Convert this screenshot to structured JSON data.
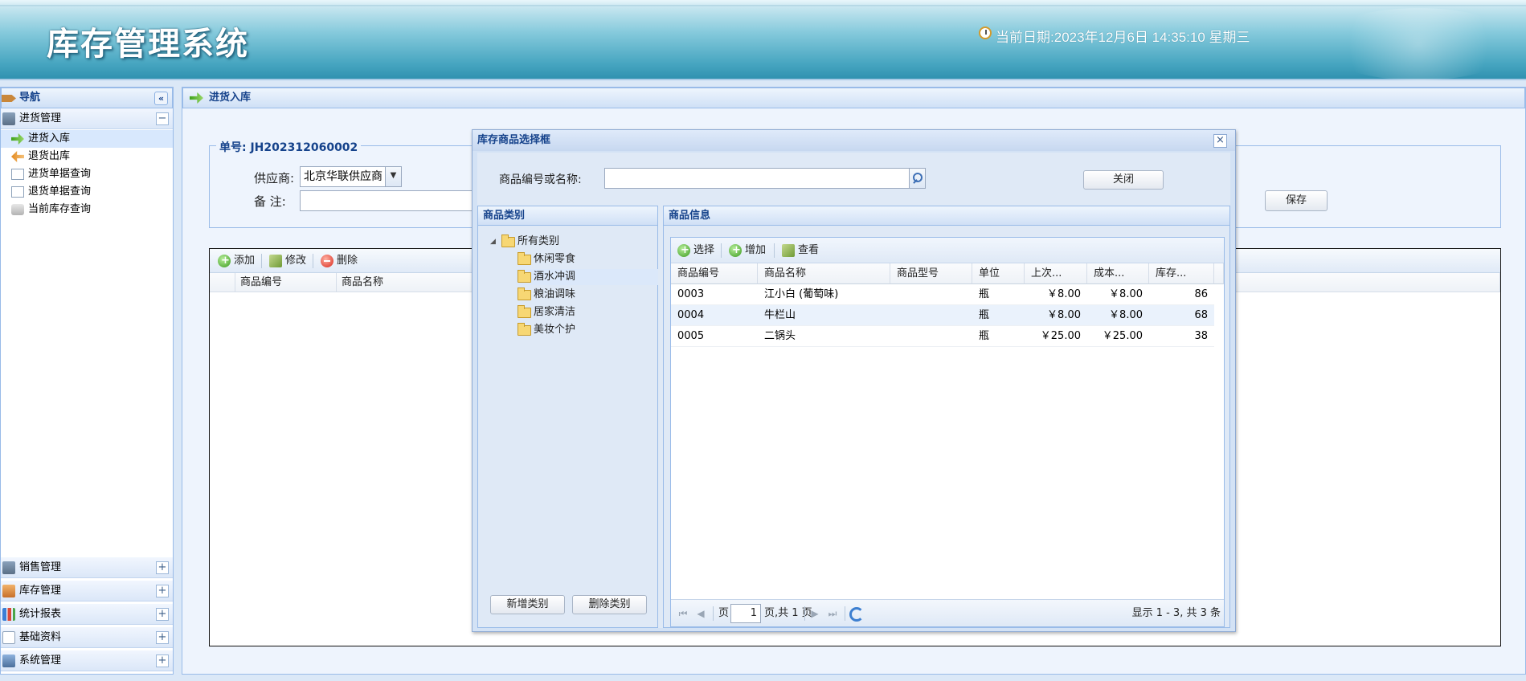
{
  "header": {
    "app_title": "库存管理系统",
    "date_label": "当前日期:",
    "date_value": "2023年12月6日 14:35:10 星期三"
  },
  "nav": {
    "title": "导航",
    "collapse": "«",
    "groups_top": [
      {
        "label": "进货管理",
        "toggle": "−"
      }
    ],
    "items": [
      {
        "label": "进货入库",
        "selected": true
      },
      {
        "label": "退货出库"
      },
      {
        "label": "进货单据查询"
      },
      {
        "label": "退货单据查询"
      },
      {
        "label": "当前库存查询"
      }
    ],
    "groups_bottom": [
      {
        "label": "销售管理",
        "toggle": "+"
      },
      {
        "label": "库存管理",
        "toggle": "+"
      },
      {
        "label": "统计报表",
        "toggle": "+"
      },
      {
        "label": "基础资料",
        "toggle": "+"
      },
      {
        "label": "系统管理",
        "toggle": "+"
      }
    ]
  },
  "main": {
    "tab_title": "进货入库",
    "order_no": "单号: JH202312060002",
    "supplier_label": "供应商:",
    "supplier_value": "北京华联供应商",
    "remark_label": "备 注:",
    "save_label": "保存",
    "toolbar": {
      "add": "添加",
      "edit": "修改",
      "delete": "删除"
    },
    "columns": [
      "商品编号",
      "商品名称"
    ]
  },
  "dialog": {
    "title": "库存商品选择框",
    "close_icon": "×",
    "search_label": "商品编号或名称:",
    "search_value": "",
    "close_button": "关闭",
    "category_panel": {
      "title": "商品类别",
      "root": "所有类别",
      "children": [
        "休闲零食",
        "酒水冲调",
        "粮油调味",
        "居家清洁",
        "美妆个护"
      ],
      "add_button": "新增类别",
      "delete_button": "删除类别"
    },
    "goods_panel": {
      "title": "商品信息",
      "toolbar": {
        "select": "选择",
        "add": "增加",
        "view": "查看"
      },
      "columns": [
        "商品编号",
        "商品名称",
        "商品型号",
        "单位",
        "上次...",
        "成本...",
        "库存..."
      ],
      "rows": [
        [
          "0003",
          "江小白 (葡萄味)",
          "",
          "瓶",
          "￥8.00",
          "￥8.00",
          "86"
        ],
        [
          "0004",
          "牛栏山",
          "",
          "瓶",
          "￥8.00",
          "￥8.00",
          "68"
        ],
        [
          "0005",
          "二锅头",
          "",
          "瓶",
          "￥25.00",
          "￥25.00",
          "38"
        ]
      ],
      "pager": {
        "page_label": "页",
        "page_value": "1",
        "page_total": "页,共 1 页",
        "summary": "显示 1 - 3, 共 3 条"
      }
    }
  }
}
